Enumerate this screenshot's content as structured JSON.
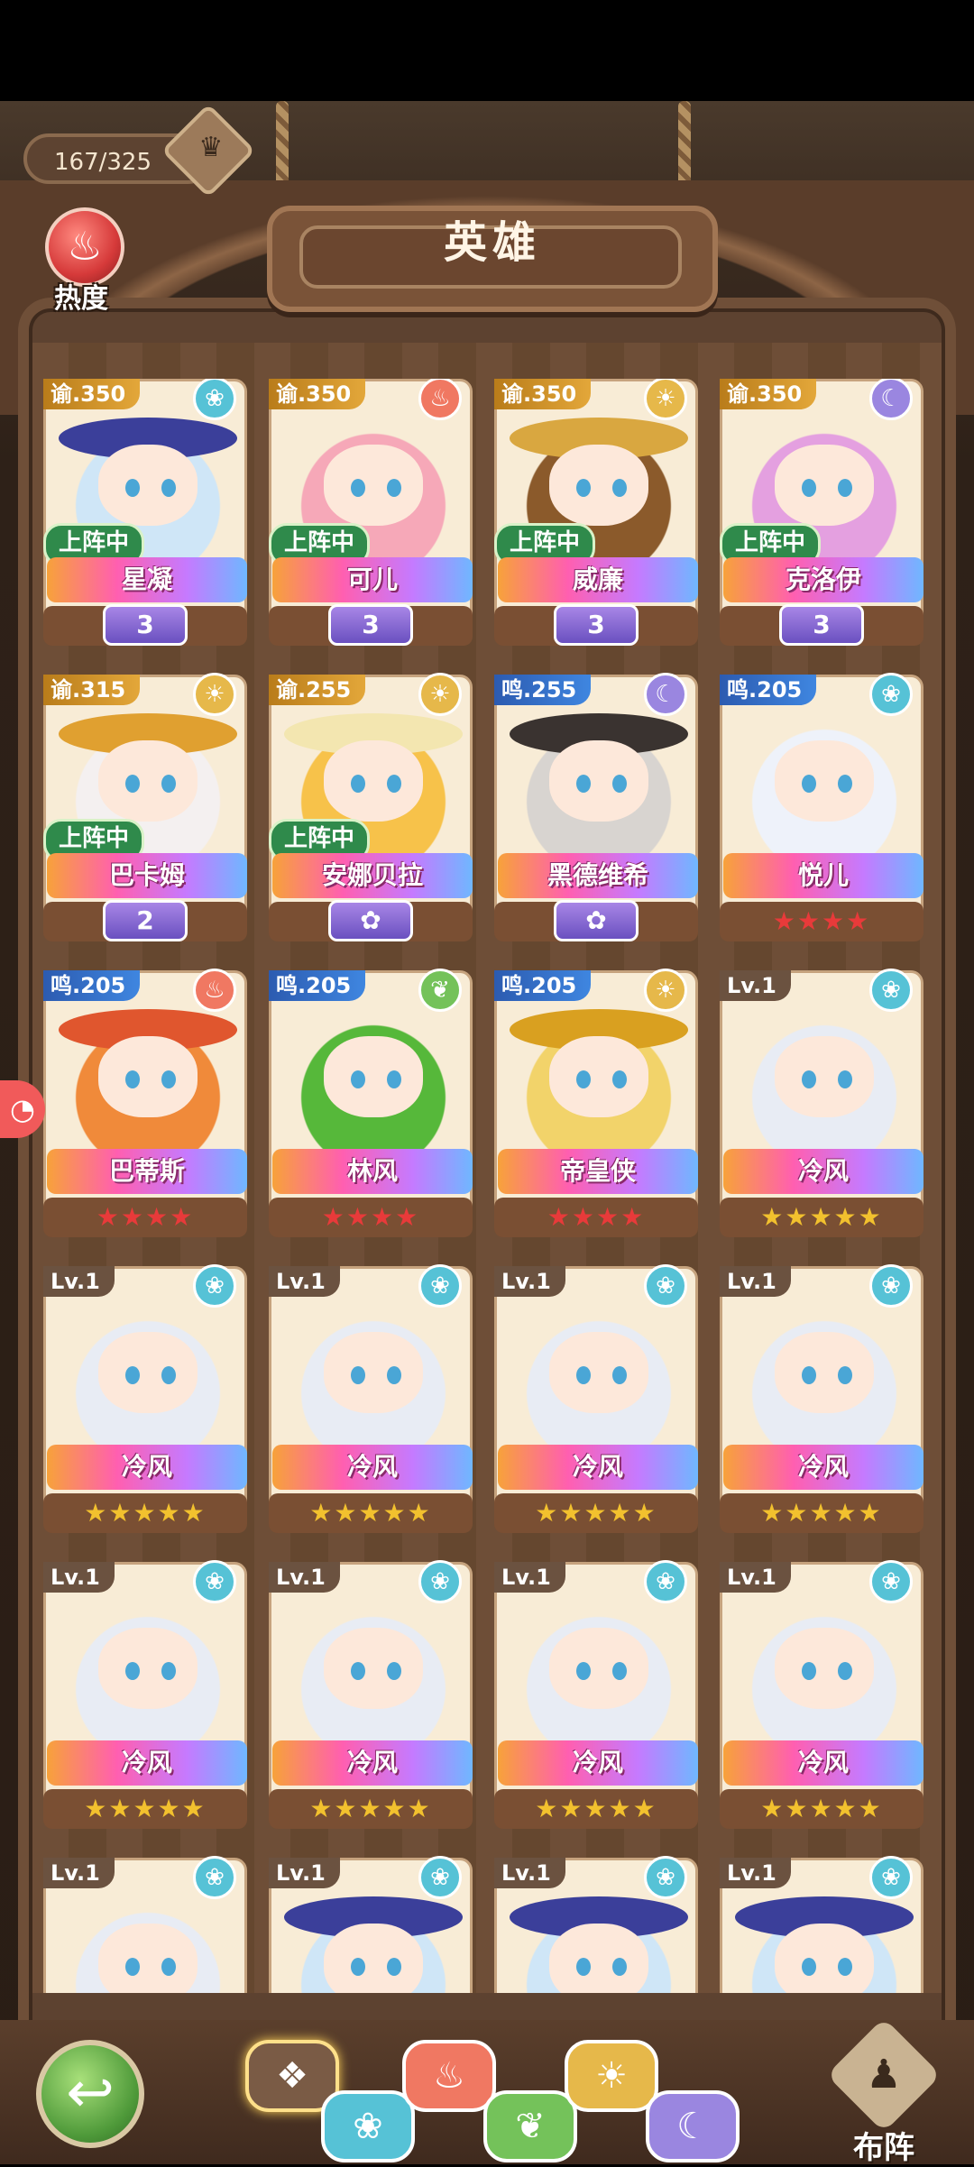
{
  "header": {
    "hero_count": "167/325",
    "title": "英雄",
    "heat_label": "热度"
  },
  "heroes": [
    {
      "badge": "谕.350",
      "badge_kind": "gold",
      "element": "water",
      "element_icon": "❀",
      "name": "星凝",
      "on_team": true,
      "on_team_label": "上阵中",
      "rank": "3",
      "stars": "",
      "hair": "#cfe6f7",
      "hat": "#3b3f9a"
    },
    {
      "badge": "谕.350",
      "badge_kind": "gold",
      "element": "fire",
      "element_icon": "♨",
      "name": "可儿",
      "on_team": true,
      "on_team_label": "上阵中",
      "rank": "3",
      "stars": "",
      "hair": "#f6a8b8",
      "hat": ""
    },
    {
      "badge": "谕.350",
      "badge_kind": "gold",
      "element": "sun",
      "element_icon": "☀",
      "name": "威廉",
      "on_team": true,
      "on_team_label": "上阵中",
      "rank": "3",
      "stars": "",
      "hair": "#8b5a2b",
      "hat": "#d9a740"
    },
    {
      "badge": "谕.350",
      "badge_kind": "gold",
      "element": "moon",
      "element_icon": "☾",
      "name": "克洛伊",
      "on_team": true,
      "on_team_label": "上阵中",
      "rank": "3",
      "stars": "",
      "hair": "#e4a0e0",
      "hat": ""
    },
    {
      "badge": "谕.315",
      "badge_kind": "gold",
      "element": "sun",
      "element_icon": "☀",
      "name": "巴卡姆",
      "on_team": true,
      "on_team_label": "上阵中",
      "rank": "2",
      "stars": "",
      "hair": "#f4f0f0",
      "hat": "#e0a030"
    },
    {
      "badge": "谕.255",
      "badge_kind": "gold",
      "element": "sun",
      "element_icon": "☀",
      "name": "安娜贝拉",
      "on_team": true,
      "on_team_label": "上阵中",
      "rank": "✿",
      "stars": "",
      "hair": "#f7c24a",
      "hat": "#f3e6b0"
    },
    {
      "badge": "鸣.255",
      "badge_kind": "blue",
      "element": "moon",
      "element_icon": "☾",
      "name": "黑德维希",
      "on_team": false,
      "on_team_label": "",
      "rank": "✿",
      "stars": "",
      "hair": "#d8d4d0",
      "hat": "#3a3330"
    },
    {
      "badge": "鸣.205",
      "badge_kind": "blue",
      "element": "water",
      "element_icon": "❀",
      "name": "悦儿",
      "on_team": false,
      "on_team_label": "",
      "rank": "",
      "stars": "★★★★",
      "stars_color": "red",
      "hair": "#eef2fa",
      "hat": ""
    },
    {
      "badge": "鸣.205",
      "badge_kind": "blue",
      "element": "fire",
      "element_icon": "♨",
      "name": "巴蒂斯",
      "on_team": false,
      "on_team_label": "",
      "rank": "",
      "stars": "★★★★",
      "stars_color": "red",
      "hair": "#f08a3a",
      "hat": "#e0562e"
    },
    {
      "badge": "鸣.205",
      "badge_kind": "blue",
      "element": "leaf",
      "element_icon": "❦",
      "name": "林风",
      "on_team": false,
      "on_team_label": "",
      "rank": "",
      "stars": "★★★★",
      "stars_color": "red",
      "hair": "#56b83a",
      "hat": ""
    },
    {
      "badge": "鸣.205",
      "badge_kind": "blue",
      "element": "sun",
      "element_icon": "☀",
      "name": "帝皇侠",
      "on_team": false,
      "on_team_label": "",
      "rank": "",
      "stars": "★★★★",
      "stars_color": "red",
      "hair": "#f2d36a",
      "hat": "#d9a020"
    },
    {
      "badge": "Lv.1",
      "badge_kind": "lv",
      "element": "water",
      "element_icon": "❀",
      "name": "冷风",
      "on_team": false,
      "on_team_label": "",
      "rank": "",
      "stars": "★★★★★",
      "stars_color": "gold",
      "hair": "#e8ecf4",
      "hat": ""
    },
    {
      "badge": "Lv.1",
      "badge_kind": "lv",
      "element": "water",
      "element_icon": "❀",
      "name": "冷风",
      "on_team": false,
      "on_team_label": "",
      "rank": "",
      "stars": "★★★★★",
      "stars_color": "gold",
      "hair": "#e8ecf4",
      "hat": ""
    },
    {
      "badge": "Lv.1",
      "badge_kind": "lv",
      "element": "water",
      "element_icon": "❀",
      "name": "冷风",
      "on_team": false,
      "on_team_label": "",
      "rank": "",
      "stars": "★★★★★",
      "stars_color": "gold",
      "hair": "#e8ecf4",
      "hat": ""
    },
    {
      "badge": "Lv.1",
      "badge_kind": "lv",
      "element": "water",
      "element_icon": "❀",
      "name": "冷风",
      "on_team": false,
      "on_team_label": "",
      "rank": "",
      "stars": "★★★★★",
      "stars_color": "gold",
      "hair": "#e8ecf4",
      "hat": ""
    },
    {
      "badge": "Lv.1",
      "badge_kind": "lv",
      "element": "water",
      "element_icon": "❀",
      "name": "冷风",
      "on_team": false,
      "on_team_label": "",
      "rank": "",
      "stars": "★★★★★",
      "stars_color": "gold",
      "hair": "#e8ecf4",
      "hat": ""
    },
    {
      "badge": "Lv.1",
      "badge_kind": "lv",
      "element": "water",
      "element_icon": "❀",
      "name": "冷风",
      "on_team": false,
      "on_team_label": "",
      "rank": "",
      "stars": "★★★★★",
      "stars_color": "gold",
      "hair": "#e8ecf4",
      "hat": ""
    },
    {
      "badge": "Lv.1",
      "badge_kind": "lv",
      "element": "water",
      "element_icon": "❀",
      "name": "冷风",
      "on_team": false,
      "on_team_label": "",
      "rank": "",
      "stars": "★★★★★",
      "stars_color": "gold",
      "hair": "#e8ecf4",
      "hat": ""
    },
    {
      "badge": "Lv.1",
      "badge_kind": "lv",
      "element": "water",
      "element_icon": "❀",
      "name": "冷风",
      "on_team": false,
      "on_team_label": "",
      "rank": "",
      "stars": "★★★★★",
      "stars_color": "gold",
      "hair": "#e8ecf4",
      "hat": ""
    },
    {
      "badge": "Lv.1",
      "badge_kind": "lv",
      "element": "water",
      "element_icon": "❀",
      "name": "冷风",
      "on_team": false,
      "on_team_label": "",
      "rank": "",
      "stars": "★★★★★",
      "stars_color": "gold",
      "hair": "#e8ecf4",
      "hat": ""
    },
    {
      "badge": "Lv.1",
      "badge_kind": "lv",
      "element": "water",
      "element_icon": "❀",
      "name": "",
      "on_team": false,
      "on_team_label": "",
      "rank": "",
      "stars": "",
      "hair": "#e8ecf4",
      "hat": ""
    },
    {
      "badge": "Lv.1",
      "badge_kind": "lv",
      "element": "water",
      "element_icon": "❀",
      "name": "",
      "on_team": false,
      "on_team_label": "",
      "rank": "",
      "stars": "",
      "hair": "#cfe6f7",
      "hat": "#3b3f9a"
    },
    {
      "badge": "Lv.1",
      "badge_kind": "lv",
      "element": "water",
      "element_icon": "❀",
      "name": "",
      "on_team": false,
      "on_team_label": "",
      "rank": "",
      "stars": "",
      "hair": "#cfe6f7",
      "hat": "#3b3f9a"
    },
    {
      "badge": "Lv.1",
      "badge_kind": "lv",
      "element": "water",
      "element_icon": "❀",
      "name": "",
      "on_team": false,
      "on_team_label": "",
      "rank": "",
      "stars": "",
      "hair": "#cfe6f7",
      "hat": "#3b3f9a"
    }
  ],
  "filters": [
    {
      "id": "all",
      "icon": "❖",
      "color": "#7a5b45",
      "selected": true
    },
    {
      "id": "water",
      "icon": "❀",
      "color": "#56c2d6",
      "selected": false
    },
    {
      "id": "fire",
      "icon": "♨",
      "color": "#f07862",
      "selected": false
    },
    {
      "id": "leaf",
      "icon": "❦",
      "color": "#74c25a",
      "selected": false
    },
    {
      "id": "sun",
      "icon": "☀",
      "color": "#e6b84a",
      "selected": false
    },
    {
      "id": "moon",
      "icon": "☾",
      "color": "#9a86e0",
      "selected": false
    }
  ],
  "footer": {
    "back_icon": "↩",
    "formation_label": "布阵",
    "formation_icon": "♟"
  },
  "side_pill_icon": "◔"
}
